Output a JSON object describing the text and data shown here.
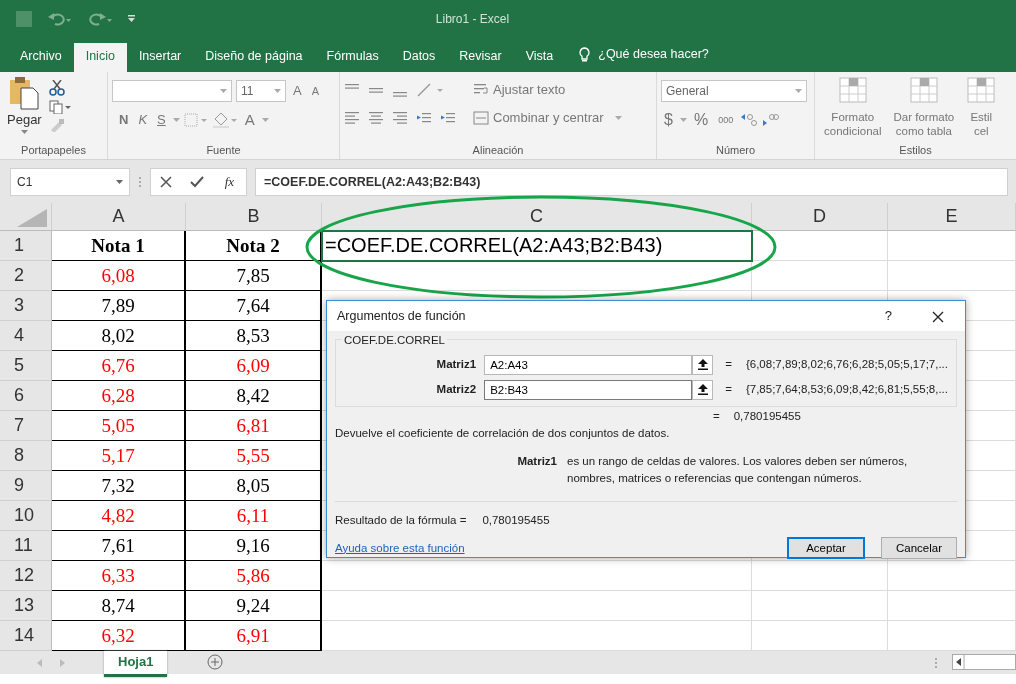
{
  "title_bar": {
    "title": "Libro1  -  Excel"
  },
  "ribbon_tabs": [
    {
      "label": "Archivo",
      "selected": false
    },
    {
      "label": "Inicio",
      "selected": true
    },
    {
      "label": "Insertar",
      "selected": false
    },
    {
      "label": "Diseño de página",
      "selected": false
    },
    {
      "label": "Fórmulas",
      "selected": false
    },
    {
      "label": "Datos",
      "selected": false
    },
    {
      "label": "Revisar",
      "selected": false
    },
    {
      "label": "Vista",
      "selected": false
    }
  ],
  "tell_me": "¿Qué desea hacer?",
  "ribbon": {
    "clipboard": {
      "paste": "Pegar",
      "group": "Portapapeles"
    },
    "font": {
      "size": "11",
      "grow": "A",
      "shrink": "A",
      "styles": [
        "N",
        "K",
        "S"
      ],
      "color_button": "A",
      "group": "Fuente"
    },
    "alignment": {
      "wrap": "Ajustar texto",
      "merge": "Combinar y centrar",
      "group": "Alineación"
    },
    "number": {
      "format": "General",
      "currency": "$",
      "percent": "%",
      "thousands": "000",
      "group": "Número"
    },
    "styles": {
      "items": [
        [
          "Formato",
          "condicional"
        ],
        [
          "Dar formato",
          "como tabla"
        ],
        [
          "Estil",
          "cel"
        ]
      ],
      "group": "Estilos"
    }
  },
  "formula_bar": {
    "name_box": "C1",
    "fx": "fx",
    "formula": "=COEF.DE.CORREL(A2:A43;B2:B43)"
  },
  "columns": [
    "A",
    "B",
    "C",
    "D",
    "E"
  ],
  "rows": [
    {
      "number": "1",
      "kind": "header",
      "cells": [
        {
          "text": "Nota 1",
          "color": "#000000"
        },
        {
          "text": "Nota 2",
          "color": "#000000"
        },
        {
          "text": "=COEF.DE.CORREL(A2:A43;B2:B43)",
          "color": "#000000",
          "selected": true
        }
      ]
    },
    {
      "number": "2",
      "kind": "data",
      "cells": [
        {
          "text": "6,08",
          "color": "#ff0000"
        },
        {
          "text": "7,85",
          "color": "#000000"
        }
      ]
    },
    {
      "number": "3",
      "kind": "data",
      "cells": [
        {
          "text": "7,89",
          "color": "#000000"
        },
        {
          "text": "7,64",
          "color": "#000000"
        }
      ]
    },
    {
      "number": "4",
      "kind": "data",
      "cells": [
        {
          "text": "8,02",
          "color": "#000000"
        },
        {
          "text": "8,53",
          "color": "#000000"
        }
      ]
    },
    {
      "number": "5",
      "kind": "data",
      "cells": [
        {
          "text": "6,76",
          "color": "#ff0000"
        },
        {
          "text": "6,09",
          "color": "#ff0000"
        }
      ]
    },
    {
      "number": "6",
      "kind": "data",
      "cells": [
        {
          "text": "6,28",
          "color": "#ff0000"
        },
        {
          "text": "8,42",
          "color": "#000000"
        }
      ]
    },
    {
      "number": "7",
      "kind": "data",
      "cells": [
        {
          "text": "5,05",
          "color": "#ff0000"
        },
        {
          "text": "6,81",
          "color": "#ff0000"
        }
      ]
    },
    {
      "number": "8",
      "kind": "data",
      "cells": [
        {
          "text": "5,17",
          "color": "#ff0000"
        },
        {
          "text": "5,55",
          "color": "#ff0000"
        }
      ]
    },
    {
      "number": "9",
      "kind": "data",
      "cells": [
        {
          "text": "7,32",
          "color": "#000000"
        },
        {
          "text": "8,05",
          "color": "#000000"
        }
      ]
    },
    {
      "number": "10",
      "kind": "data",
      "cells": [
        {
          "text": "4,82",
          "color": "#ff0000"
        },
        {
          "text": "6,11",
          "color": "#ff0000"
        }
      ]
    },
    {
      "number": "11",
      "kind": "data",
      "cells": [
        {
          "text": "7,61",
          "color": "#000000"
        },
        {
          "text": "9,16",
          "color": "#000000"
        }
      ]
    },
    {
      "number": "12",
      "kind": "data",
      "cells": [
        {
          "text": "6,33",
          "color": "#ff0000"
        },
        {
          "text": "5,86",
          "color": "#ff0000"
        }
      ]
    },
    {
      "number": "13",
      "kind": "data",
      "cells": [
        {
          "text": "8,74",
          "color": "#000000"
        },
        {
          "text": "9,24",
          "color": "#000000"
        }
      ]
    },
    {
      "number": "14",
      "kind": "data",
      "cells": [
        {
          "text": "6,32",
          "color": "#ff0000"
        },
        {
          "text": "6,91",
          "color": "#ff0000"
        }
      ]
    }
  ],
  "dialog": {
    "title": "Argumentos de función",
    "help": "?",
    "function_name": "COEF.DE.CORREL",
    "arguments": [
      {
        "label": "Matriz1",
        "value": "A2:A43",
        "equals": "=",
        "result": "{6,08;7,89;8,02;6,76;6,28;5,05;5,17;7,...",
        "focused": false
      },
      {
        "label": "Matriz2",
        "value": "B2:B43",
        "equals": "=",
        "result": "{7,85;7,64;8,53;6,09;8,42;6,81;5,55;8,...",
        "focused": true
      }
    ],
    "total_equals": "=",
    "total": "0,780195455",
    "description": "Devuelve el coeficiente de correlación de dos conjuntos de datos.",
    "arg_help": {
      "label": "Matriz1",
      "text": "es un rango de celdas de valores. Los valores deben ser números, nombres, matrices o referencias que contengan números."
    },
    "result_label": "Resultado de la fórmula =",
    "result": "0,780195455",
    "help_link": "Ayuda sobre esta función",
    "buttons": [
      {
        "label": "Aceptar",
        "default": true
      },
      {
        "label": "Cancelar",
        "default": false
      }
    ]
  },
  "sheet_tabs": [
    {
      "label": "Hoja1",
      "selected": true
    }
  ]
}
